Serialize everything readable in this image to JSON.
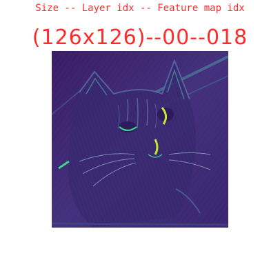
{
  "caption": "Size -- Layer idx -- Feature map idx",
  "headline": "(126x126)--00--018",
  "colors": {
    "text": "#ff2a2a",
    "map_background": "#3f1f6b",
    "map_mid": "#46357f",
    "map_highlight": "#3fd18f",
    "map_peak": "#c6e633"
  },
  "image": {
    "subject": "viridis-colormap feature map of a cat face"
  }
}
